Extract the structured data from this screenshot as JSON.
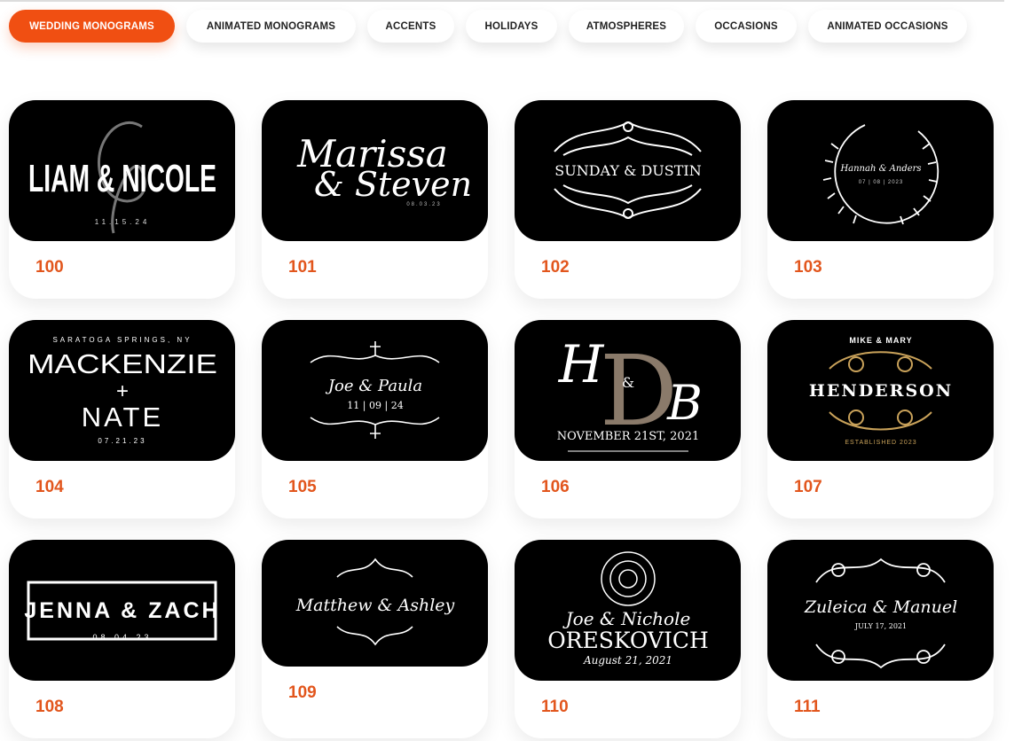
{
  "tabs": [
    {
      "label": "WEDDING MONOGRAMS",
      "active": true
    },
    {
      "label": "ANIMATED MONOGRAMS"
    },
    {
      "label": "ACCENTS"
    },
    {
      "label": "HOLIDAYS"
    },
    {
      "label": "ATMOSPHERES"
    },
    {
      "label": "OCCASIONS"
    },
    {
      "label": "ANIMATED OCCASIONS"
    }
  ],
  "cards": [
    {
      "number": "100",
      "lines": [
        "LIAM & NICOLE",
        "11.15.24"
      ]
    },
    {
      "number": "101",
      "lines": [
        "Marissa",
        "& Steven",
        "08.03.23"
      ]
    },
    {
      "number": "102",
      "lines": [
        "SUNDAY & DUSTIN"
      ]
    },
    {
      "number": "103",
      "lines": [
        "Hannah & Anders",
        "07 | 08 | 2023"
      ]
    },
    {
      "number": "104",
      "lines": [
        "SARATOGA SPRINGS, NY",
        "MACKENZIE",
        "+",
        "NATE",
        "07.21.23"
      ]
    },
    {
      "number": "105",
      "lines": [
        "Joe & Paula",
        "11 | 09 | 24"
      ]
    },
    {
      "number": "106",
      "lines": [
        "H",
        "&",
        "D",
        "B",
        "NOVEMBER 21ST, 2021"
      ]
    },
    {
      "number": "107",
      "lines": [
        "MIKE & MARY",
        "HENDERSON",
        "ESTABLISHED 2023"
      ]
    },
    {
      "number": "108",
      "lines": [
        "JENNA & ZACH",
        "08.04.23"
      ]
    },
    {
      "number": "109",
      "lines": [
        "Matthew & Ashley"
      ]
    },
    {
      "number": "110",
      "lines": [
        "Joe & Nichole",
        "ORESKOVICH",
        "August 21, 2021"
      ]
    },
    {
      "number": "111",
      "lines": [
        "Zuleica & Manuel",
        "JULY 17, 2021"
      ]
    }
  ]
}
